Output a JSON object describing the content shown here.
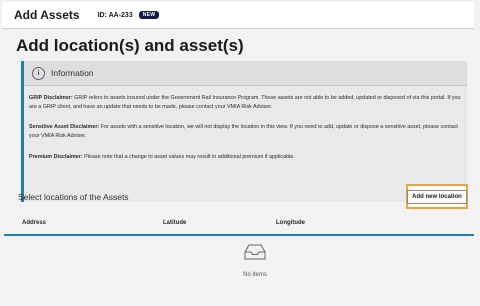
{
  "header": {
    "title": "Add Assets",
    "id_label": "ID: AA-233",
    "badge": "NEW"
  },
  "page_title": "Add location(s) and asset(s)",
  "information": {
    "title": "Information",
    "grip_label": "GRIP Disclaimer:",
    "grip_text": " GRIP refers to assets insured under the Government Rail Insurance Program. These assets are not able to be added, updated or disposed of via this portal. If you are a GRIP client, and have an update that needs to be made, please contact your VMIA Risk Adviser.",
    "sensitive_label": "Sensitive Asset Disclaimer:",
    "sensitive_text": " For assets with a sensitive location, we will not display the location in this view. If you need to add, update or dispose a sensitive asset, please contact your VMIA Risk Adviser.",
    "premium_label": "Premium Disclaimer:",
    "premium_text": " Please note that a change to asset values may result in additional premium if applicable."
  },
  "locations": {
    "title": "Select locations of the Assets",
    "add_button": "Add new location",
    "columns": [
      "Address",
      "Latitude",
      "Longitude"
    ],
    "empty_text": "No items"
  },
  "icons": {
    "info": "info-icon",
    "empty": "inbox-tray-icon"
  },
  "colors": {
    "accent": "#1f7fa8",
    "highlight": "#f0a13a",
    "badge_bg": "#0e1a4a"
  }
}
